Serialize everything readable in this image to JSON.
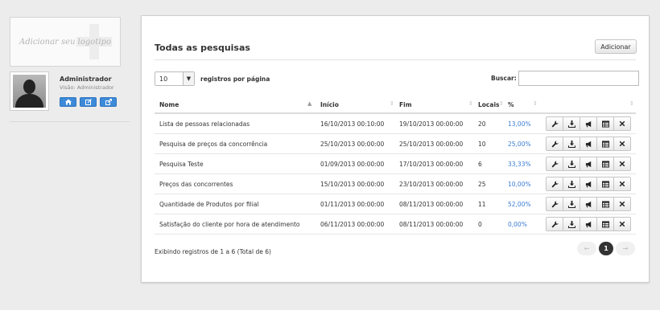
{
  "sidebar": {
    "logo_placeholder": "Adicionar seu logotipo",
    "user": {
      "name": "Administrador",
      "role": "Visão: Administrador"
    },
    "user_buttons": [
      "home-icon",
      "edit-icon",
      "share-icon"
    ]
  },
  "main": {
    "title": "Todas as pesquisas",
    "add_button": "Adicionar",
    "page_size": "10",
    "page_size_label": "registros por página",
    "search_label": "Buscar:",
    "search_value": "",
    "columns": [
      "Nome",
      "Início",
      "Fim",
      "Locais",
      "%"
    ],
    "rows": [
      {
        "name": "Lista de pessoas relacionadas",
        "start": "16/10/2013 00:10:00",
        "end": "19/10/2013 00:00:00",
        "locations": "20",
        "pct": "13,00%"
      },
      {
        "name": "Pesquisa de preços da concorrência",
        "start": "25/10/2013 00:00:00",
        "end": "25/10/2013 00:00:00",
        "locations": "10",
        "pct": "25,00%"
      },
      {
        "name": "Pesquisa Teste",
        "start": "01/09/2013 00:00:00",
        "end": "17/10/2013 00:00:00",
        "locations": "6",
        "pct": "33,33%"
      },
      {
        "name": "Preços das concorrentes",
        "start": "15/10/2013 00:00:00",
        "end": "23/10/2013 00:00:00",
        "locations": "25",
        "pct": "10,00%"
      },
      {
        "name": "Quantidade de Produtos por filial",
        "start": "01/11/2013 00:00:00",
        "end": "08/11/2013 00:00:00",
        "locations": "11",
        "pct": "52,00%"
      },
      {
        "name": "Satisfação do cliente por hora de atendimento",
        "start": "06/11/2013 00:00:00",
        "end": "08/11/2013 00:00:00",
        "locations": "0",
        "pct": "0,00%"
      }
    ],
    "row_actions": [
      "wrench-icon",
      "download-icon",
      "megaphone-icon",
      "table-icon",
      "close-icon"
    ],
    "summary": "Exibindo registros de 1 a 6 (Total de 6)",
    "pagination": {
      "prev": "←",
      "current": "1",
      "next": "→"
    },
    "colors": {
      "link": "#3a7bd5",
      "user_button": "#3d8ad9"
    }
  }
}
